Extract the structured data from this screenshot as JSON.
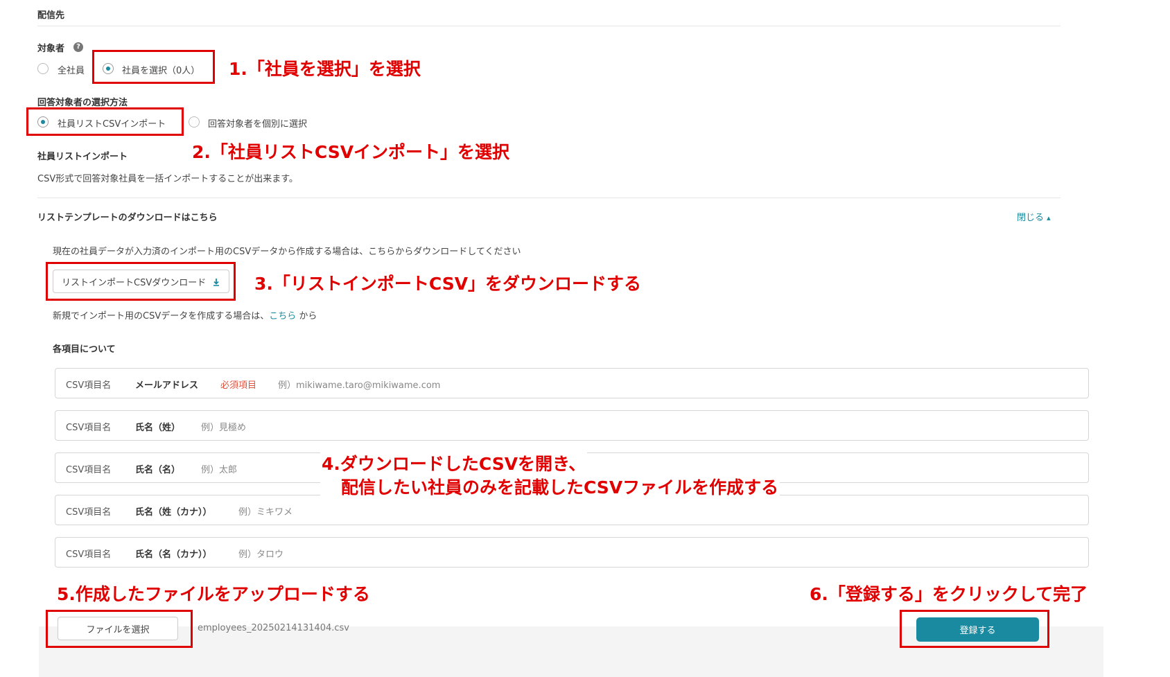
{
  "section": {
    "title": "配信先"
  },
  "target": {
    "label": "対象者",
    "help_icon": "?",
    "options": [
      "全社員",
      "社員を選択（0人）"
    ],
    "selected_index": 1
  },
  "method": {
    "label": "回答対象者の選択方法",
    "options": [
      "社員リストCSVインポート",
      "回答対象者を個別に選択"
    ],
    "selected_index": 0
  },
  "import": {
    "title": "社員リストインポート",
    "description": "CSV形式で回答対象社員を一括インポートすることが出来ます。"
  },
  "template": {
    "title": "リストテンプレートのダウンロードはこちら",
    "toggle_label": "閉じる",
    "existing_note": "現在の社員データが入力済のインポート用のCSVデータから作成する場合は、こちらからダウンロードしてください",
    "download_button": "リストインポートCSVダウンロード",
    "new_note_prefix": "新規でインポート用のCSVデータを作成する場合は、",
    "new_note_link": "こちら",
    "new_note_suffix": " から"
  },
  "fields": {
    "title": "各項目について",
    "column_label": "CSV項目名",
    "rows": [
      {
        "name": "メールアドレス",
        "required": "必須項目",
        "example": "例）mikiwame.taro@mikiwame.com"
      },
      {
        "name": "氏名（姓）",
        "required": "",
        "example": "例）見極め"
      },
      {
        "name": "氏名（名）",
        "required": "",
        "example": "例）太郎"
      },
      {
        "name": "氏名（姓（カナ））",
        "required": "",
        "example": "例）ミキワメ"
      },
      {
        "name": "氏名（名（カナ））",
        "required": "",
        "example": "例）タロウ"
      }
    ]
  },
  "footer": {
    "file_button": "ファイルを選択",
    "file_name": "employees_20250214131404.csv",
    "submit_button": "登録する"
  },
  "annotations": {
    "step1": "1.「社員を選択」を選択",
    "step2": "2.「社員リストCSVインポート」を選択",
    "step3": "3.「リストインポートCSV」をダウンロードする",
    "step4_line1": "4.ダウンロードしたCSVを開き、",
    "step4_line2": "配信したい社員のみを記載したCSVファイルを作成する",
    "step5": "5.作成したファイルをアップロードする",
    "step6": "6.「登録する」をクリックして完了",
    "color": "#e00000"
  },
  "colors": {
    "accent": "#1a8aa0",
    "required": "#e0513b"
  }
}
